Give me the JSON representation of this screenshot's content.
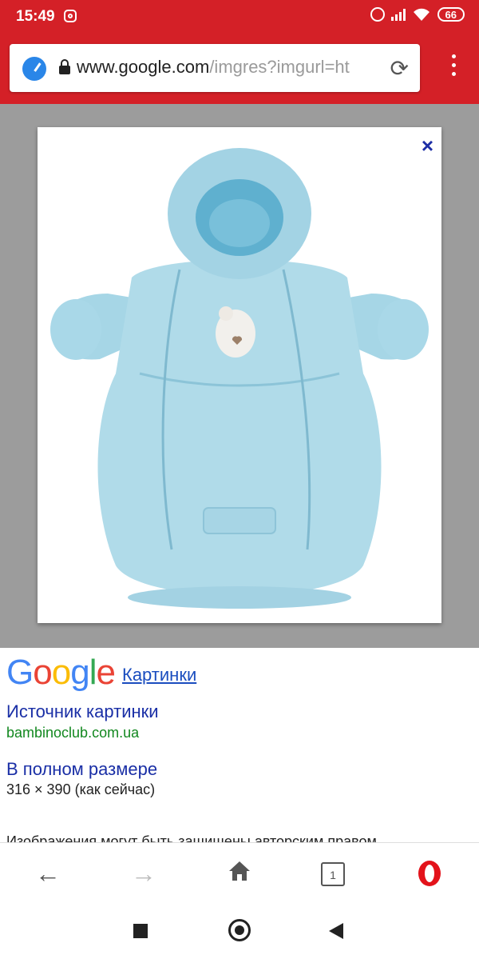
{
  "status_bar": {
    "time": "15:49",
    "battery": "66"
  },
  "browser": {
    "url_host": "www.google.com",
    "url_path": "/imgres?imgurl=ht",
    "accent_color": "#d42027"
  },
  "image_viewer": {
    "close_label": "×"
  },
  "result": {
    "logo_letters": [
      "G",
      "o",
      "o",
      "g",
      "l",
      "e"
    ],
    "logo_colors": [
      "#4285f4",
      "#ea4335",
      "#fbbc05",
      "#4285f4",
      "#34a853",
      "#ea4335"
    ],
    "pictures_link": "Картинки",
    "source_title": "Источник картинки",
    "source_url": "bambinoclub.com.ua",
    "full_size_title": "В полном размере",
    "full_size_value": "316 × 390 (как сейчас)",
    "copyright_note": "Изображения могут быть защищены авторским правом"
  },
  "bottom_nav": {
    "back": "←",
    "forward": "→",
    "tabs_count": "1"
  },
  "icons": {
    "speed_dial": "speed-dial-icon",
    "lock": "lock-icon",
    "reload": "reload-icon",
    "menu": "overflow-menu-icon",
    "home": "home-icon",
    "opera": "opera-icon"
  }
}
